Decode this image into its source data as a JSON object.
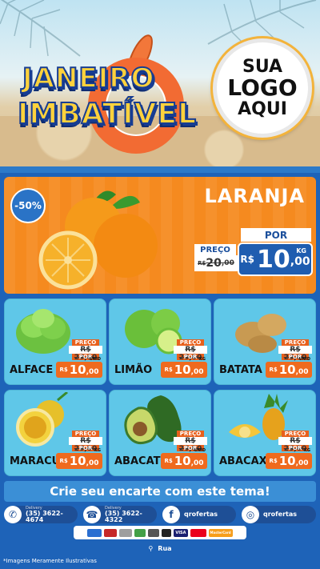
{
  "header": {
    "title_line1": "JANEIRO",
    "title_line2": "IMBATÍVEL",
    "logo_line1": "SUA",
    "logo_line2": "LOGO",
    "logo_line3": "AQUI"
  },
  "hero": {
    "discount": "-50%",
    "name": "LARANJA",
    "por_label": "POR",
    "preco_label": "PREÇO",
    "old_currency": "R$",
    "old_int": "20",
    "old_dec": ",00",
    "new_currency": "R$",
    "new_int": "10",
    "new_dec": ",00",
    "unit": "KG"
  },
  "products": [
    {
      "name": "ALFACE",
      "preco_label": "PREÇO",
      "old": "R$ 20,00",
      "por_label": "POR",
      "currency": "R$",
      "int": "10",
      "dec": ",00",
      "unit": "UNID"
    },
    {
      "name": "LIMÃO",
      "preco_label": "PREÇO",
      "old": "R$ 20,00",
      "por_label": "POR",
      "currency": "R$",
      "int": "10",
      "dec": ",00",
      "unit": "KG"
    },
    {
      "name": "BATATA",
      "preco_label": "PREÇO",
      "old": "R$ 20,00",
      "por_label": "POR",
      "currency": "R$",
      "int": "10",
      "dec": ",00",
      "unit": "UNID"
    },
    {
      "name": "MARACUJÁ",
      "preco_label": "PREÇO",
      "old": "R$ 20,00",
      "por_label": "POR",
      "currency": "R$",
      "int": "10",
      "dec": ",00",
      "unit": "KG"
    },
    {
      "name": "ABACATE",
      "preco_label": "PREÇO",
      "old": "R$ 20,00",
      "por_label": "POR",
      "currency": "R$",
      "int": "10",
      "dec": ",00",
      "unit": "UNID"
    },
    {
      "name": "ABACAXI",
      "preco_label": "PREÇO",
      "old": "R$ 20,00",
      "por_label": "POR",
      "currency": "R$",
      "int": "10",
      "dec": ",00",
      "unit": "KG"
    }
  ],
  "cta": "Crie seu encarte com este tema!",
  "contacts": {
    "whatsapp_label": "Delivery",
    "whatsapp_phone": "(35) 3622-4674",
    "phone_label": "Delivery",
    "phone_number": "(35) 3622-4322",
    "facebook": "qrofertas",
    "instagram": "qrofertas"
  },
  "payments": [
    "VISA",
    "MasterCard"
  ],
  "address": "Rua",
  "disclaimer": "*Imagens Meramente Ilustrativas",
  "colors": {
    "orange": "#f58a1f",
    "blue": "#1f5db0",
    "card": "#5fc7e8",
    "price": "#ef6a1e"
  }
}
